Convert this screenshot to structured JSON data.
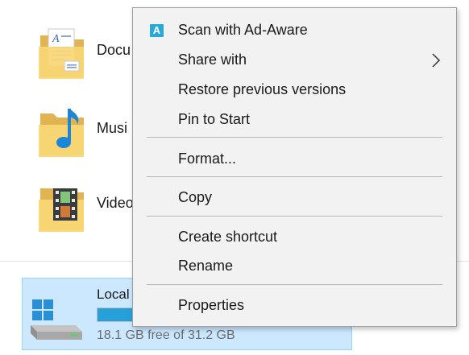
{
  "folders": [
    {
      "label": "Docu",
      "icon": "documents-folder-icon"
    },
    {
      "label": "Musi",
      "icon": "music-folder-icon"
    },
    {
      "label": "Video",
      "icon": "videos-folder-icon"
    }
  ],
  "drive": {
    "label": "Local",
    "free_text": "18.1 GB free of 31.2 GB",
    "used_fraction": 0.42,
    "icon": "windows-drive-icon"
  },
  "context_menu": {
    "scan": {
      "label": "Scan with Ad-Aware",
      "icon": "ad-aware-icon",
      "icon_letter": "A"
    },
    "share": {
      "label": "Share with",
      "icon": "chevron-right-icon"
    },
    "restore": {
      "label": "Restore previous versions"
    },
    "pin": {
      "label": "Pin to Start"
    },
    "format": {
      "label": "Format..."
    },
    "copy": {
      "label": "Copy"
    },
    "shortcut": {
      "label": "Create shortcut"
    },
    "rename": {
      "label": "Rename"
    },
    "properties": {
      "label": "Properties"
    }
  },
  "colors": {
    "selection_bg": "#cce8ff",
    "selection_border": "#99d1ff",
    "drive_bar": "#26a0da",
    "menu_bg": "#f2f2f2",
    "ad_aware_blue": "#28a9d8"
  }
}
